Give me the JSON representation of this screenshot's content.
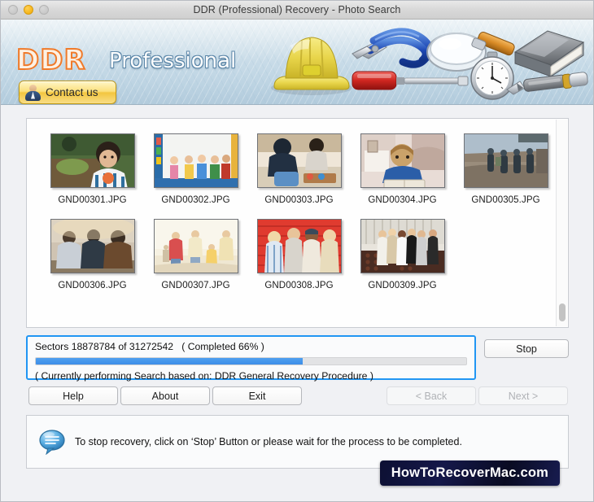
{
  "window": {
    "title": "DDR (Professional) Recovery - Photo Search",
    "controls": {
      "close": "close-button",
      "minimize": "minimize-button",
      "zoom": "zoom-button"
    }
  },
  "banner": {
    "logo_main": "DDR",
    "logo_sub": "Professional",
    "contact_button": "Contact us",
    "icons": [
      "hard-hat-icon",
      "pliers-icon",
      "screwdriver-icon",
      "magnifier-icon",
      "stopwatch-icon",
      "book-icon",
      "pen-icon"
    ]
  },
  "thumbnails": [
    {
      "label": "GND00301.JPG"
    },
    {
      "label": "GND00302.JPG"
    },
    {
      "label": "GND00303.JPG"
    },
    {
      "label": "GND00304.JPG"
    },
    {
      "label": "GND00305.JPG"
    },
    {
      "label": "GND00306.JPG"
    },
    {
      "label": "GND00307.JPG"
    },
    {
      "label": "GND00308.JPG"
    },
    {
      "label": "GND00309.JPG"
    }
  ],
  "progress": {
    "sectors_text": "Sectors 18878784 of 31272542   ( Completed 66% )",
    "sectors_done": 18878784,
    "sectors_total": 31272542,
    "percent": 66,
    "fill_percent": 62,
    "current_action": "( Currently performing Search based on: DDR General Recovery Procedure )",
    "stop_label": "Stop",
    "accent_color": "#2196f3"
  },
  "buttons": {
    "help": "Help",
    "about": "About",
    "exit": "Exit",
    "back": "< Back",
    "next": "Next >"
  },
  "status": {
    "message": "To stop recovery, click on ‘Stop’ Button or please wait for the process to be completed.",
    "icon": "speech-bubble-icon"
  },
  "watermark": {
    "text": "HowToRecoverMac.com"
  }
}
